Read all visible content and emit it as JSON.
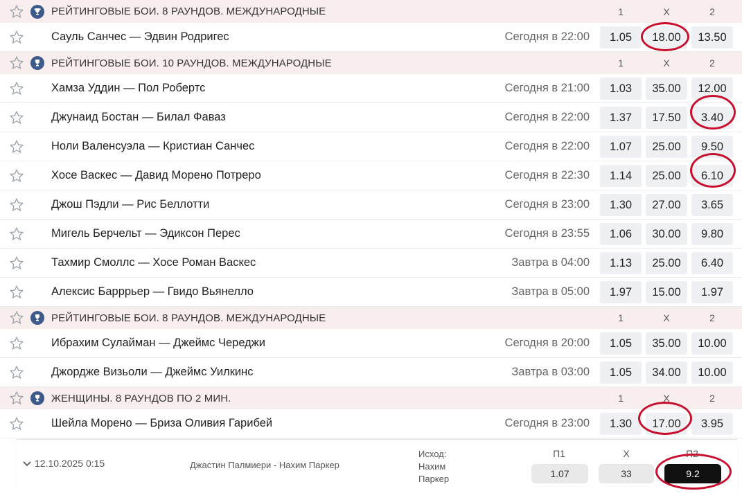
{
  "columns": {
    "c1": "1",
    "cx": "X",
    "c2": "2"
  },
  "sections": [
    {
      "title": "РЕЙТИНГОВЫЕ БОИ. 8 РАУНДОВ. МЕЖДУНАРОДНЫЕ",
      "matches": [
        {
          "name": "Сауль Санчес — Эдвин Родригес",
          "time": "Сегодня в 22:00",
          "o1": "1.05",
          "ox": "18.00",
          "o2": "13.50"
        }
      ]
    },
    {
      "title": "РЕЙТИНГОВЫЕ БОИ. 10 РАУНДОВ. МЕЖДУНАРОДНЫЕ",
      "matches": [
        {
          "name": "Хамза Уддин — Пол Робертс",
          "time": "Сегодня в 21:00",
          "o1": "1.03",
          "ox": "35.00",
          "o2": "12.00"
        },
        {
          "name": "Джунаид Бостан — Билал Фаваз",
          "time": "Сегодня в 22:00",
          "o1": "1.37",
          "ox": "17.50",
          "o2": "3.40"
        },
        {
          "name": "Ноли Валенсуэла — Кристиан Санчес",
          "time": "Сегодня в 22:00",
          "o1": "1.07",
          "ox": "25.00",
          "o2": "9.50"
        },
        {
          "name": "Хосе Васкес — Давид Морено Потреро",
          "time": "Сегодня в 22:30",
          "o1": "1.14",
          "ox": "25.00",
          "o2": "6.10"
        },
        {
          "name": "Джош Пэдли — Рис Беллотти",
          "time": "Сегодня в 23:00",
          "o1": "1.30",
          "ox": "27.00",
          "o2": "3.65"
        },
        {
          "name": "Мигель Берчельт — Эдиксон Перес",
          "time": "Сегодня в 23:55",
          "o1": "1.06",
          "ox": "30.00",
          "o2": "9.80"
        },
        {
          "name": "Тахмир Смоллс — Хосе Роман Васкес",
          "time": "Завтра в 04:00",
          "o1": "1.13",
          "ox": "25.00",
          "o2": "6.40"
        },
        {
          "name": "Алексис Барррьер — Гвидо Вьянелло",
          "time": "Завтра в 05:00",
          "o1": "1.97",
          "ox": "15.00",
          "o2": "1.97"
        }
      ]
    },
    {
      "title": "РЕЙТИНГОВЫЕ БОИ. 8 РАУНДОВ. МЕЖДУНАРОДНЫЕ",
      "matches": [
        {
          "name": "Ибрахим Сулайман — Джеймс Череджи",
          "time": "Сегодня в 20:00",
          "o1": "1.05",
          "ox": "35.00",
          "o2": "10.00"
        },
        {
          "name": "Джордже Визьоли — Джеймс Уилкинс",
          "time": "Завтра в 03:00",
          "o1": "1.05",
          "ox": "34.00",
          "o2": "10.00"
        }
      ]
    },
    {
      "title": "ЖЕНЩИНЫ. 8 РАУНДОВ ПО 2 МИН.",
      "matches": [
        {
          "name": "Шейла Морено — Бриза Оливия Гарибей",
          "time": "Сегодня в 23:00",
          "o1": "1.30",
          "ox": "17.00",
          "o2": "3.95"
        }
      ]
    }
  ],
  "bet_slip": {
    "date": "12.10.2025 0:15",
    "match": "Джастин Палмиери - Нахим Паркер",
    "outcome_lines": [
      "Исход:",
      "Нахим",
      "Паркер"
    ],
    "labels": {
      "p1": "П1",
      "x": "X",
      "p2": "П2"
    },
    "odds": {
      "p1": "1.07",
      "x": "33",
      "p2": "9.2"
    },
    "selected": "p2"
  },
  "highlight_color": "#c8102e",
  "icons": {
    "favorite": "star-outline-icon",
    "league": "trophy-icon",
    "expand": "chevron-down-icon"
  }
}
